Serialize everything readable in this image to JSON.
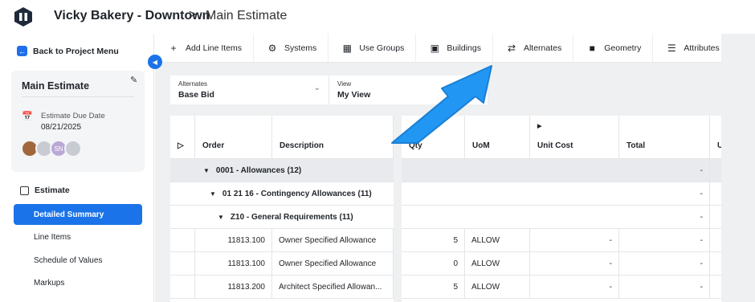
{
  "header": {
    "project_title": "Vicky Bakery - Downtown",
    "separator": ">",
    "page_heading": "Main Estimate"
  },
  "sidebar": {
    "back_label": "Back to Project Menu",
    "card": {
      "title": "Main Estimate",
      "due_label": "Estimate Due Date",
      "due_date": "08/21/2025",
      "avatars": [
        {
          "initials": "",
          "color": "#a0673c"
        },
        {
          "initials": "",
          "color": "#c8ccd2"
        },
        {
          "initials": "SN",
          "color": "#b9a8d6"
        },
        {
          "initials": "",
          "color": "#c8ccd2"
        }
      ]
    },
    "section_label": "Estimate",
    "items": [
      {
        "label": "Detailed Summary",
        "active": true
      },
      {
        "label": "Line Items",
        "active": false
      },
      {
        "label": "Schedule of Values",
        "active": false
      },
      {
        "label": "Markups",
        "active": false
      }
    ]
  },
  "toolbar": {
    "items": [
      {
        "label": "Add Line Items",
        "icon": "plus-icon"
      },
      {
        "label": "Systems",
        "icon": "gears-icon"
      },
      {
        "label": "Use Groups",
        "icon": "building-group-icon"
      },
      {
        "label": "Buildings",
        "icon": "blueprint-icon"
      },
      {
        "label": "Alternates",
        "icon": "swap-arrows-icon"
      },
      {
        "label": "Geometry",
        "icon": "cube-icon"
      },
      {
        "label": "Attributes",
        "icon": "list-icon"
      }
    ]
  },
  "filters": {
    "alternates_label": "Alternates",
    "alternates_value": "Base Bid",
    "view_label": "View",
    "view_value": "My View"
  },
  "grid": {
    "columns": {
      "order": "Order",
      "description": "Description",
      "qty": "Qty",
      "uom": "UoM",
      "unit_cost": "Unit Cost",
      "total": "Total",
      "extra": "U"
    },
    "groups": [
      {
        "label": "0001 - Allowances (12)",
        "total": "-"
      },
      {
        "label": "01 21 16 - Contingency Allowances (11)",
        "total": "-"
      },
      {
        "label": "Z10 - General Requirements (11)",
        "total": "-"
      }
    ],
    "rows": [
      {
        "order": "11813.100",
        "description": "Owner Specified Allowance",
        "qty": "5",
        "uom": "ALLOW",
        "unit_cost": "-",
        "total": "-"
      },
      {
        "order": "11813.100",
        "description": "Owner Specified Allowance",
        "qty": "0",
        "uom": "ALLOW",
        "unit_cost": "-",
        "total": "-"
      },
      {
        "order": "11813.200",
        "description": "Architect Specified Allowan...",
        "qty": "5",
        "uom": "ALLOW",
        "unit_cost": "-",
        "total": "-"
      }
    ]
  },
  "colors": {
    "accent": "#1a73e8",
    "arrow": "#2196f3",
    "group_row": "#e8eaed"
  }
}
